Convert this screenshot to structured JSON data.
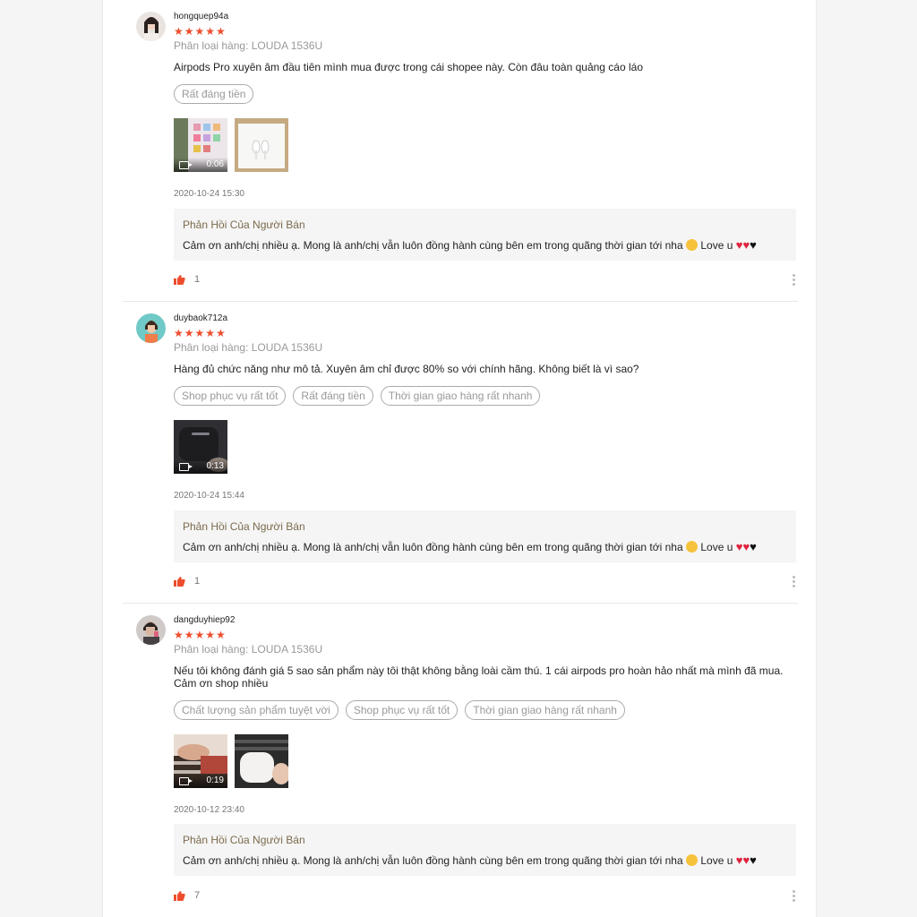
{
  "reviews": [
    {
      "username": "hongquep94a",
      "stars": "★★★★★",
      "variant": "Phân loại hàng: LOUDA 1536U",
      "content": "Airpods Pro xuyên âm đầu tiên mình mua được trong cái shopee này. Còn đâu toàn quảng cáo láo",
      "tags": [
        "Rất đáng tiền"
      ],
      "video_duration": "0:06",
      "timestamp": "2020-10-24 15:30",
      "reply_title": "Phản Hồi Của Người Bán",
      "reply_text": "Cảm ơn anh/chị nhiều ạ. Mong là anh/chị vẫn luôn đồng hành cùng bên em  trong quãng thời gian tới nha",
      "reply_suffix": "Love u",
      "likes": "1"
    },
    {
      "username": "duybaok712a",
      "stars": "★★★★★",
      "variant": "Phân loại hàng: LOUDA 1536U",
      "content": "Hàng đủ chức năng như mô tả. Xuyên âm chỉ được 80% so với chính hãng. Không biết là vì sao?",
      "tags": [
        "Shop phục vụ rất tốt",
        "Rất đáng tiền",
        "Thời gian giao hàng rất nhanh"
      ],
      "video_duration": "0:13",
      "timestamp": "2020-10-24 15:44",
      "reply_title": "Phản Hồi Của Người Bán",
      "reply_text": "Cảm ơn anh/chị nhiều ạ. Mong là anh/chị vẫn luôn đồng hành cùng bên em  trong quãng thời gian tới nha",
      "reply_suffix": "Love u",
      "likes": "1"
    },
    {
      "username": "dangduyhiep92",
      "stars": "★★★★★",
      "variant": "Phân loại hàng: LOUDA 1536U",
      "content": "Nếu tôi không đánh giá 5 sao sản phẩm này tôi thật không bằng loài cầm thú. 1 cái airpods pro hoàn hảo nhất mà mình đã mua. Cảm ơn shop nhiều",
      "tags": [
        "Chất lượng sản phẩm tuyệt vời",
        "Shop phục vụ rất tốt",
        "Thời gian giao hàng rất nhanh"
      ],
      "video_duration": "0:19",
      "timestamp": "2020-10-12 23:40",
      "reply_title": "Phản Hồi Của Người Bán",
      "reply_text": "Cảm ơn anh/chị nhiều ạ. Mong là anh/chị vẫn luôn đồng hành cùng bên em  trong quãng thời gian tới nha",
      "reply_suffix": "Love u",
      "likes": "7"
    }
  ],
  "colors": {
    "star": "#ee4d2d",
    "reply_title": "#7b6a4c",
    "heart": "#e0223c"
  },
  "icons": {
    "like": "thumbs-up-icon",
    "more": "more-vertical-icon",
    "video": "video-camera-icon",
    "emoji": "kissing-face-emoji"
  }
}
